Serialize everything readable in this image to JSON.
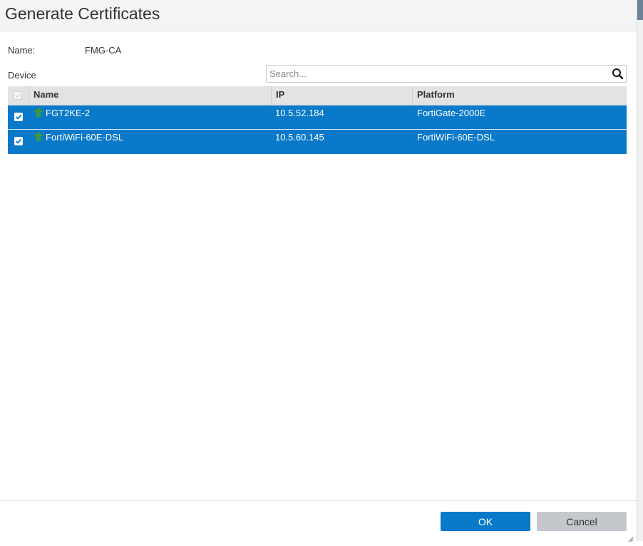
{
  "dialog": {
    "title": "Generate Certificates"
  },
  "form": {
    "name_label": "Name:",
    "name_value": "FMG-CA",
    "device_label": "Device"
  },
  "search": {
    "placeholder": "Search...",
    "value": ""
  },
  "table": {
    "columns": {
      "name": "Name",
      "ip": "IP",
      "platform": "Platform"
    },
    "rows": [
      {
        "name": "FGT2KE-2",
        "ip": "10.5.52.184",
        "platform": "FortiGate-2000E",
        "selected": true,
        "status_icon": "green-up-arrow-icon"
      },
      {
        "name": "FortiWiFi-60E-DSL",
        "ip": "10.5.60.145",
        "platform": "FortiWiFi-60E-DSL",
        "selected": true,
        "status_icon": "green-up-arrow-icon"
      }
    ]
  },
  "footer": {
    "ok_label": "OK",
    "cancel_label": "Cancel"
  },
  "colors": {
    "selection": "#0a79c9",
    "primary_button": "#0a79c9",
    "secondary_button": "#c4c8cc",
    "status_up": "#3d9b35"
  }
}
